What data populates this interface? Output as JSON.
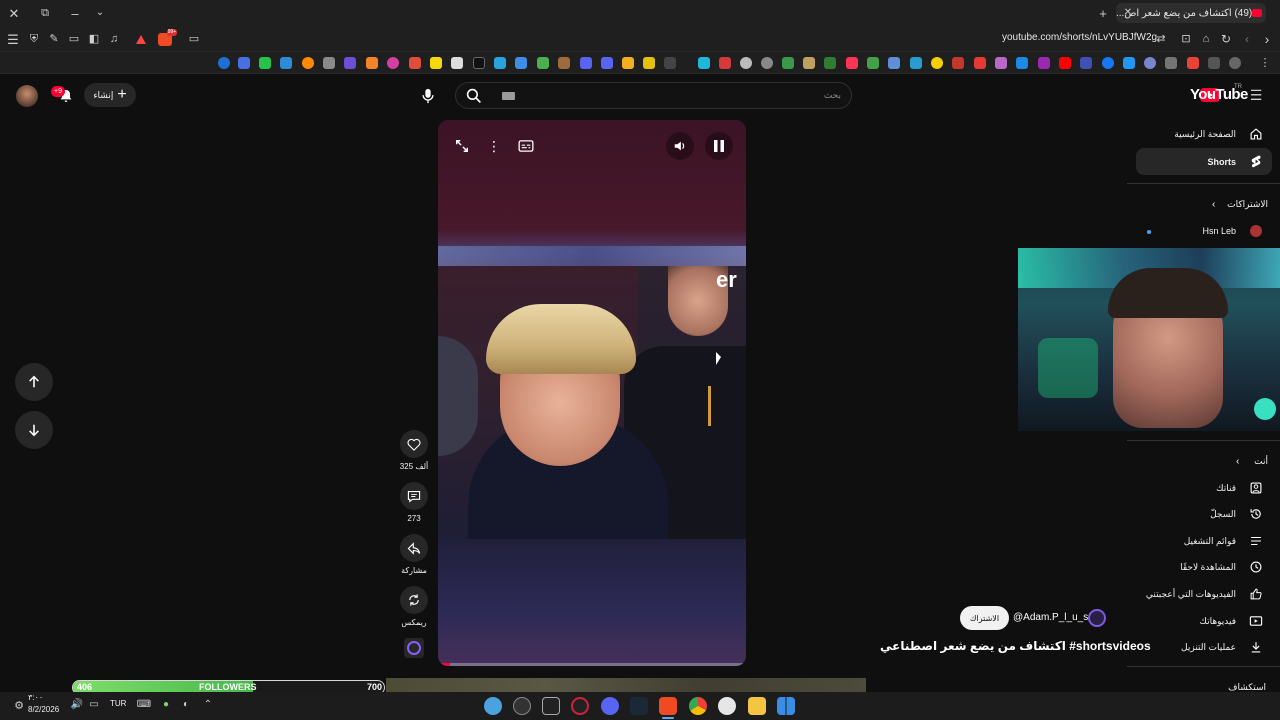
{
  "browser": {
    "tab_title": "(49) اكتشاف من يضع شعر اص...",
    "url": "youtube.com/shorts/nLvYUBJfW2g"
  },
  "header": {
    "logo_text": "YouTube",
    "logo_region": "TR",
    "search_placeholder": "بحث",
    "create_label": "إنشاء",
    "notifications_badge": "+9"
  },
  "guide": {
    "home": "الصفحة الرئيسية",
    "shorts": "Shorts",
    "subscriptions_header": "الاشتراكات",
    "subscription_channel": "Hsn Leb",
    "you_header": "أنت",
    "items": [
      {
        "label": "قناتك",
        "icon": "channel-icon"
      },
      {
        "label": "السجلّ",
        "icon": "history-icon"
      },
      {
        "label": "قوائم التشغيل",
        "icon": "playlist-icon"
      },
      {
        "label": "المشاهدة لاحقًا",
        "icon": "clock-icon"
      },
      {
        "label": "الفيديوهات التي أعجبتني",
        "icon": "thumbs-up-icon"
      },
      {
        "label": "فيديوهاتك",
        "icon": "video-icon"
      },
      {
        "label": "عمليات التنزيل",
        "icon": "download-icon"
      }
    ],
    "more_header": "استكشاف"
  },
  "short": {
    "channel_handle": "@Adam.P_l_u_s",
    "subscribe_label": "الاشتراك",
    "title": "اكتشاف من يضع شعر اصطناعي #shortsvideos",
    "overlay_text": "er",
    "progress_fraction": 0.04
  },
  "actions": {
    "likes": "325 ألف",
    "comments": "273",
    "share": "مشاركة",
    "remix": "ريمكس"
  },
  "followers_widget": {
    "current": "406",
    "label": "FOLLOWERS",
    "goal": "700",
    "fill_fraction": 0.58
  },
  "taskbar": {
    "time": "٣:٠٠",
    "date": "8/2/2026",
    "language": "TUR"
  },
  "colors": {
    "youtube_red": "#ff0033",
    "followers_green": "#5ccf55"
  }
}
